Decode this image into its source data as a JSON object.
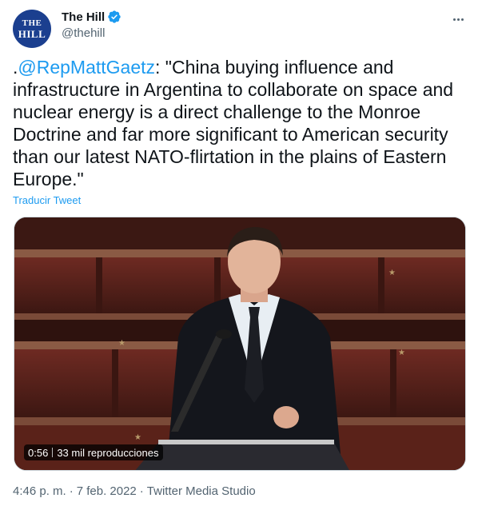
{
  "author": {
    "avatar_line1": "THE",
    "avatar_line2": "HILL",
    "display_name": "The Hill",
    "handle": "@thehill",
    "verified": true
  },
  "tweet": {
    "prefix": ".",
    "mention": "@RepMattGaetz",
    "body": ": \"China buying influence and infrastructure in Argentina to collaborate on space and nuclear energy is a direct challenge to the Monroe Doctrine and far more significant to American security than our latest NATO-flirtation in the plains of Eastern Europe.\"",
    "translate_label": "Traducir Tweet"
  },
  "media": {
    "duration": "0:56",
    "views": "33 mil reproducciones"
  },
  "meta": {
    "time": "4:46 p. m.",
    "separator": "·",
    "date": "7 feb. 2022",
    "source": "Twitter Media Studio"
  },
  "colors": {
    "accent": "#1d9bf0",
    "text": "#0f1419",
    "secondary": "#536471",
    "avatar_bg": "#1b3f8f"
  },
  "icons": [
    "verified-badge-icon",
    "more-icon"
  ]
}
